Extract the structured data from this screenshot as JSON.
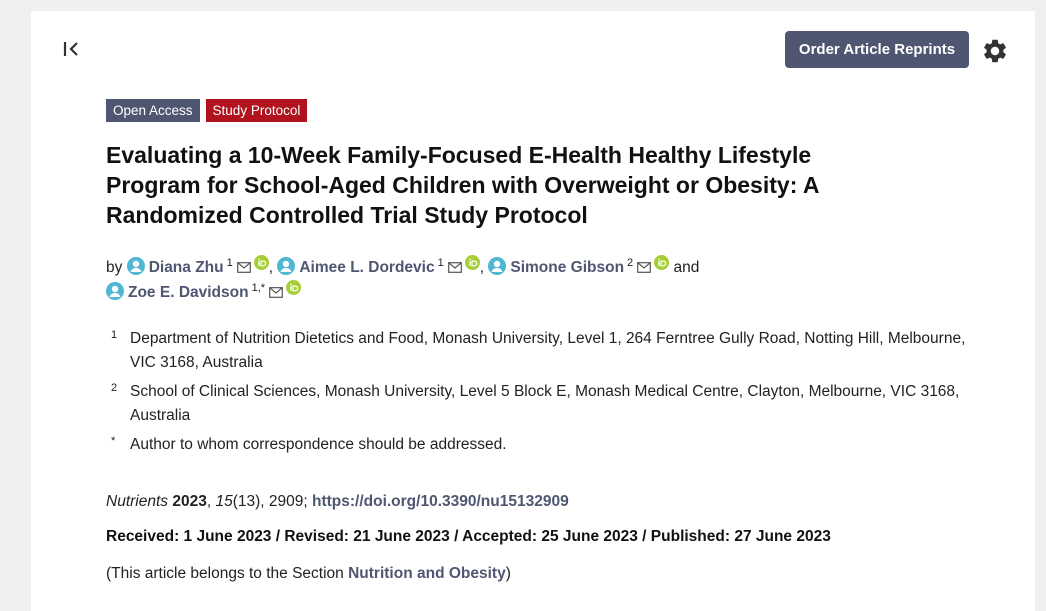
{
  "header": {
    "reprints_label": "Order Article Reprints",
    "collapse_icon": "collapse-left-icon",
    "settings_icon": "gear-icon"
  },
  "badges": [
    {
      "label": "Open Access",
      "color": "#4f5671"
    },
    {
      "label": "Study Protocol",
      "color": "#b0131d"
    }
  ],
  "article": {
    "title_line1": "Evaluating a 10-Week Family-Focused E-Health Healthy Lifestyle",
    "title_line2": "Program for School-Aged Children with Overweight or Obesity: A",
    "title_line3": "Randomized Controlled Trial Study Protocol",
    "by": "by",
    "authors": [
      {
        "name": "Diana Zhu",
        "sup": "1"
      },
      {
        "name": "Aimee L. Dordevic",
        "sup": "1"
      },
      {
        "name": "Simone Gibson",
        "sup": "2"
      },
      {
        "name": "Zoe E. Davidson",
        "sup": "1,*"
      }
    ],
    "and": "and",
    "affiliations": [
      {
        "num": "1",
        "text": "Department of Nutrition Dietetics and Food, Monash University, Level 1, 264 Ferntree Gully Road, Notting Hill, Melbourne, VIC 3168, Australia"
      },
      {
        "num": "2",
        "text": "School of Clinical Sciences, Monash University, Level 5 Block E, Monash Medical Centre, Clayton, Melbourne, VIC 3168, Australia"
      },
      {
        "num": "*",
        "text": "Author to whom correspondence should be addressed."
      }
    ],
    "citation": {
      "journal": "Nutrients",
      "year": "2023",
      "volume": "15",
      "rest": "(13), 2909; ",
      "doi": "https://doi.org/10.3390/nu15132909"
    },
    "dates": "Received: 1 June 2023 / Revised: 21 June 2023 / Accepted: 25 June 2023 / Published: 27 June 2023",
    "section_prefix": "(This article belongs to the Section ",
    "section_name": "Nutrition and Obesity",
    "section_suffix": ")"
  },
  "colors": {
    "accent": "#4f5671",
    "protocol": "#b0131d",
    "orcid": "#a6ce39",
    "person": "#4fb6d4"
  }
}
